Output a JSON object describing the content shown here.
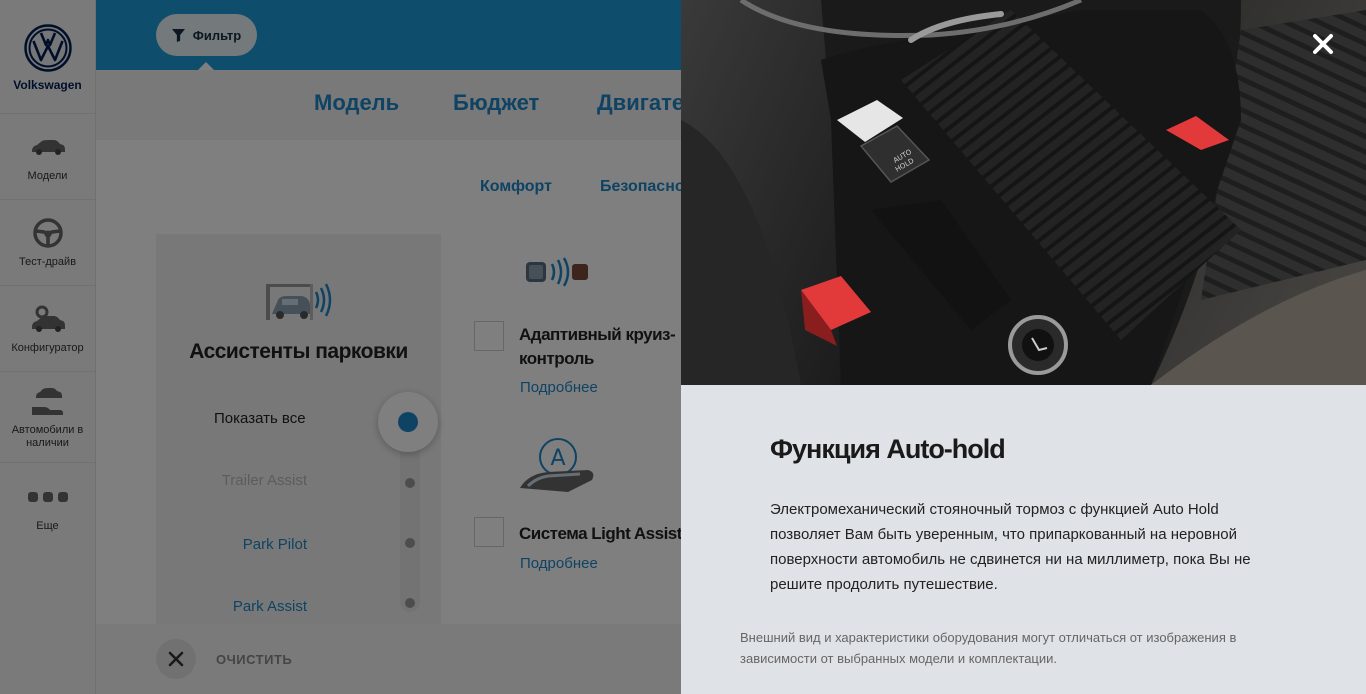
{
  "sidebar": {
    "brand": "Volkswagen",
    "items": [
      {
        "label": "Модели",
        "icon": "car-icon"
      },
      {
        "label": "Тест-драйв",
        "icon": "steering-wheel-icon"
      },
      {
        "label": "Конфигуратор",
        "icon": "car-gear-icon"
      },
      {
        "label": "Автомобили в наличии",
        "icon": "car-hand-icon"
      },
      {
        "label": "Еще",
        "icon": "more-dots-icon"
      }
    ]
  },
  "topbar": {
    "filter_label": "Фильтр"
  },
  "main": {
    "tabs": [
      "Модель",
      "Бюджет",
      "Двигатель"
    ],
    "subtabs": [
      "Комфорт",
      "Безопасность"
    ],
    "category": {
      "title": "Ассистенты парковки",
      "show_all": "Показать все",
      "options": [
        "Trailer Assist",
        "Park Pilot",
        "Park Assist"
      ]
    },
    "features": [
      {
        "name": "Адаптивный круиз-контроль",
        "more": "Подробнее"
      },
      {
        "name": "Система Light Assist",
        "more": "Подробнее"
      }
    ],
    "clear_label": "ОЧИСТИТЬ"
  },
  "modal": {
    "title": "Функция Auto-hold",
    "description": "Электромеханический стояночный тормоз с функцией Auto Hold позволяет Вам быть уверенным, что припаркованный на неровной поверхности автомобиль не сдвинется ни на миллиметр, пока Вы не решите продолить путешествие.",
    "note": "Внешний вид и характеристики оборудования могут отличаться от изображения в зависимости от выбранных модели и комплектации.",
    "button_labels": [
      "AUTO HOLD"
    ]
  },
  "colors": {
    "accent": "#1f86c8",
    "topbar": "#1f9bd8",
    "modal_bg": "#dfe2e6",
    "overlay": "rgba(0,0,0,0.5)"
  }
}
